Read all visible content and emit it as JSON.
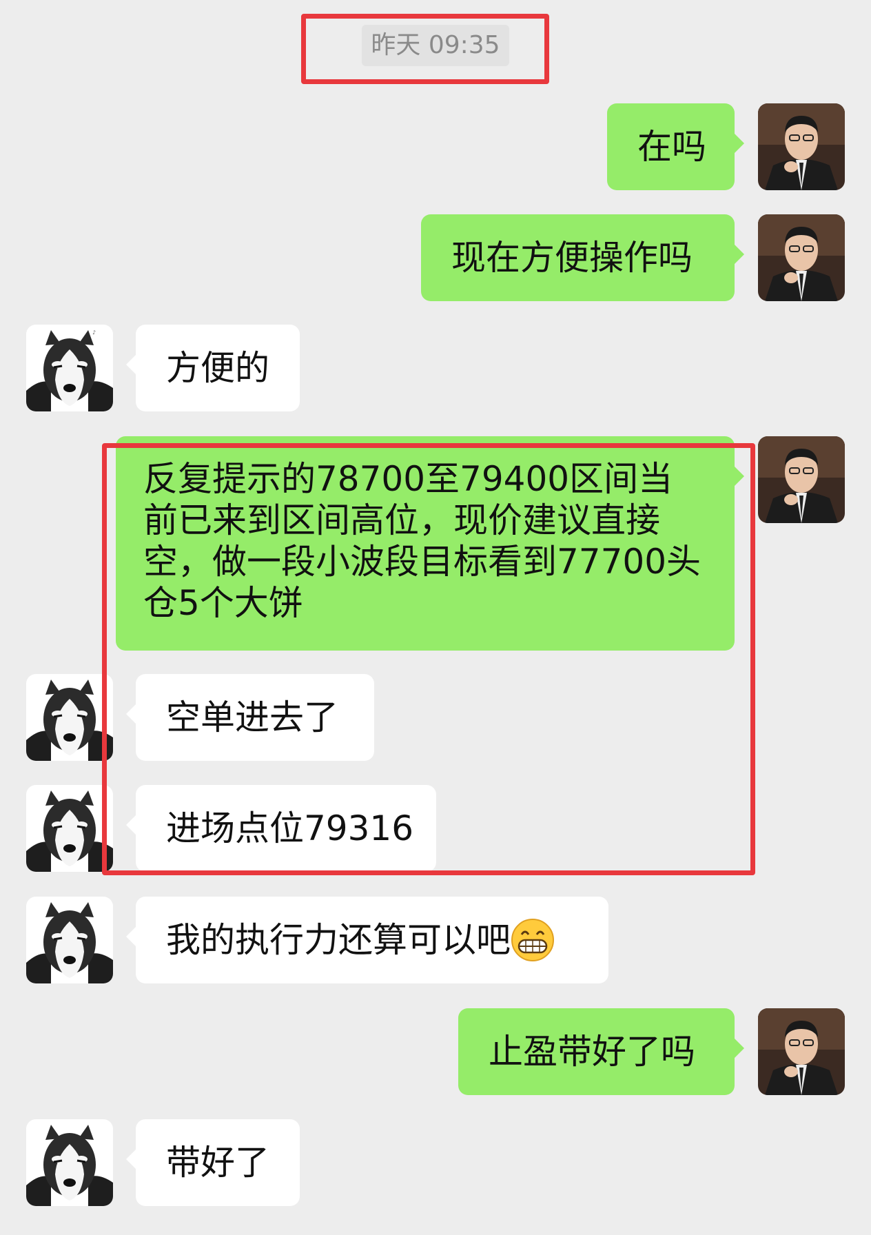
{
  "timestamp": "昨天 09:35",
  "messages": [
    {
      "side": "sent",
      "text": "在吗"
    },
    {
      "side": "sent",
      "text": "现在方便操作吗"
    },
    {
      "side": "received",
      "text": "方便的"
    },
    {
      "side": "sent",
      "text": "反复提示的78700至79400区间当前已来到区间高位，现价建议直接空，做一段小波段目标看到77700头仓5个大饼"
    },
    {
      "side": "received",
      "text": "空单进去了"
    },
    {
      "side": "received",
      "text": "进场点位79316"
    },
    {
      "side": "received",
      "text": "我的执行力还算可以吧",
      "emoji": "grinning-face-icon"
    },
    {
      "side": "sent",
      "text": "止盈带好了吗"
    },
    {
      "side": "received",
      "text": "带好了"
    }
  ],
  "colors": {
    "background": "#ededed",
    "sent_bubble": "#95ec69",
    "received_bubble": "#ffffff",
    "highlight_box": "#e8383d",
    "timestamp_text": "#8a8a8a"
  }
}
